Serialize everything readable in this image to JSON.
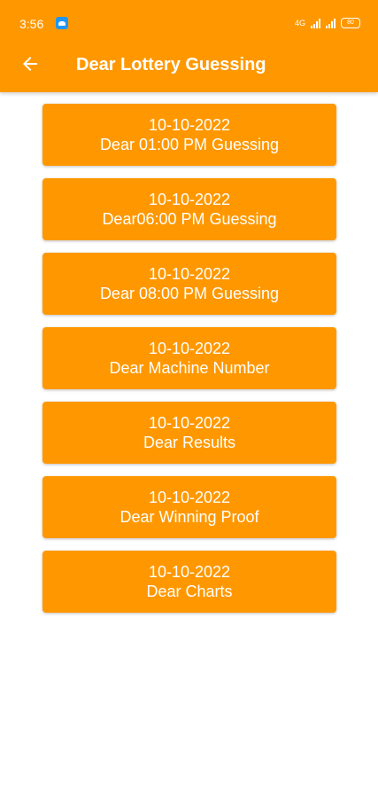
{
  "status_bar": {
    "time": "3:56",
    "app_icon": "cloud-app-icon",
    "signal_label": "4G",
    "battery": "80"
  },
  "toolbar": {
    "back_icon": "arrow-left-icon",
    "title": "Dear Lottery Guessing"
  },
  "items": [
    {
      "date": "10-10-2022",
      "label": "Dear 01:00 PM Guessing"
    },
    {
      "date": "10-10-2022",
      "label": "Dear06:00 PM Guessing"
    },
    {
      "date": "10-10-2022",
      "label": "Dear 08:00 PM Guessing"
    },
    {
      "date": "10-10-2022",
      "label": "Dear Machine Number"
    },
    {
      "date": "10-10-2022",
      "label": "Dear Results"
    },
    {
      "date": "10-10-2022",
      "label": "Dear Winning Proof"
    },
    {
      "date": "10-10-2022",
      "label": "Dear Charts"
    }
  ],
  "colors": {
    "primary": "#FF9800",
    "text_on_primary": "#FFFFFF",
    "background": "#FFFFFF"
  }
}
